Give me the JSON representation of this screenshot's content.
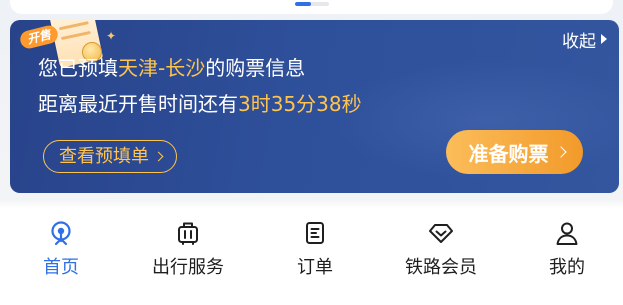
{
  "banner": {
    "tag": "开售",
    "collapse_label": "收起",
    "line1_prefix": "您已预填",
    "route_from": "天津",
    "route_separator": "-",
    "route_to": "长沙",
    "line1_suffix": "的购票信息",
    "line2_prefix": "距离最近开售时间还有",
    "countdown": "3时35分38秒",
    "view_button_label": "查看预填单",
    "prepare_button_label": "准备购票"
  },
  "tabbar": {
    "items": [
      {
        "label": "首页",
        "icon": "home-icon",
        "active": true
      },
      {
        "label": "出行服务",
        "icon": "luggage-icon",
        "active": false
      },
      {
        "label": "订单",
        "icon": "order-list-icon",
        "active": false
      },
      {
        "label": "铁路会员",
        "icon": "diamond-icon",
        "active": false
      },
      {
        "label": "我的",
        "icon": "user-icon",
        "active": false
      }
    ]
  },
  "colors": {
    "banner_bg": "#2e4f9a",
    "highlight": "#ffc44d",
    "prepare_button": "#f29a2a",
    "active_tab": "#2f6fe8",
    "tab_text": "#1f1f1f"
  }
}
